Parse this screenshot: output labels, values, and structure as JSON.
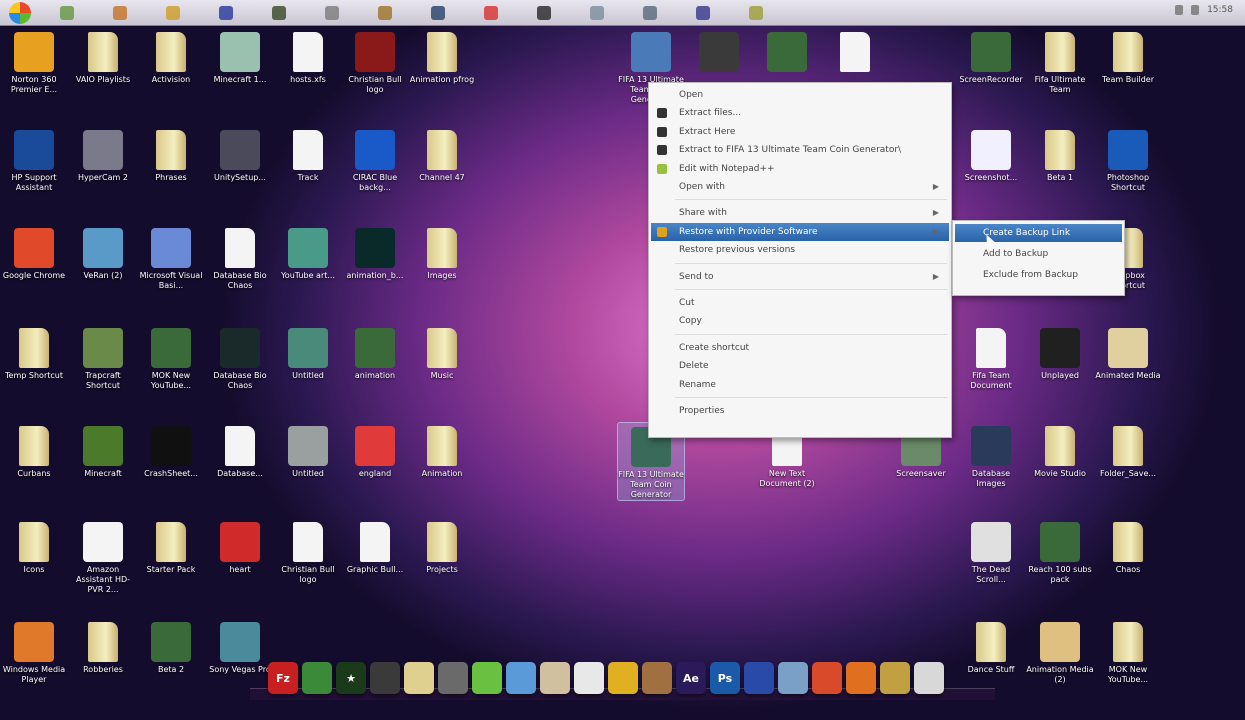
{
  "taskbar": {
    "clock": "15:58",
    "icons": [
      "#6a9a4a",
      "#c87830",
      "#d0a030",
      "#3040a0",
      "#405030",
      "#808080",
      "#a07830",
      "#304a70",
      "#d83a3a",
      "#303030",
      "#8090a0",
      "#607080",
      "#404090",
      "#a0a040"
    ]
  },
  "desktop_icons": [
    {
      "label": "Norton 360 Premier E...",
      "type": "app",
      "color": "#e8a020",
      "col": 0,
      "row": 0
    },
    {
      "label": "VAIO Playlists",
      "type": "folder",
      "col": 1,
      "row": 0
    },
    {
      "label": "Activision",
      "type": "folder",
      "col": 2,
      "row": 0
    },
    {
      "label": "Minecraft 1...",
      "type": "app",
      "color": "#9ac0b0",
      "col": 3,
      "row": 0
    },
    {
      "label": "hosts.xfs",
      "type": "doc",
      "col": 4,
      "row": 0
    },
    {
      "label": "Christian Bull logo",
      "type": "app",
      "color": "#8a1a1a",
      "col": 5,
      "row": 0
    },
    {
      "label": "Animation pfrog",
      "type": "folder",
      "col": 6,
      "row": 0
    },
    {
      "label": "HP Support Assistant",
      "type": "app",
      "color": "#1a4a9a",
      "col": 0,
      "row": 1
    },
    {
      "label": "HyperCam 2",
      "type": "app",
      "color": "#7a7a8a",
      "col": 1,
      "row": 1
    },
    {
      "label": "Phrases",
      "type": "folder",
      "col": 2,
      "row": 1
    },
    {
      "label": "UnitySetup...",
      "type": "app",
      "color": "#4a4a5a",
      "col": 3,
      "row": 1
    },
    {
      "label": "Track",
      "type": "doc",
      "col": 4,
      "row": 1
    },
    {
      "label": "CIRAC Blue backg...",
      "type": "app",
      "color": "#1a5ac8",
      "col": 5,
      "row": 1
    },
    {
      "label": "Channel 47",
      "type": "folder",
      "col": 6,
      "row": 1
    },
    {
      "label": "Google Chrome",
      "type": "app",
      "color": "#e04a2a",
      "col": 0,
      "row": 2
    },
    {
      "label": "VeRan (2)",
      "type": "app",
      "color": "#5a9ac8",
      "col": 1,
      "row": 2
    },
    {
      "label": "Microsoft Visual Basi...",
      "type": "app",
      "color": "#6a8ad8",
      "col": 2,
      "row": 2
    },
    {
      "label": "Database Bio Chaos",
      "type": "doc",
      "col": 3,
      "row": 2
    },
    {
      "label": "YouTube art...",
      "type": "app",
      "color": "#4a9a8a",
      "col": 4,
      "row": 2
    },
    {
      "label": "animation_b...",
      "type": "app",
      "color": "#0a2a2a",
      "col": 5,
      "row": 2
    },
    {
      "label": "Images",
      "type": "folder",
      "col": 6,
      "row": 2
    },
    {
      "label": "Temp Shortcut",
      "type": "folder",
      "col": 0,
      "row": 3
    },
    {
      "label": "Trapcraft Shortcut",
      "type": "app",
      "color": "#6a8a4a",
      "col": 1,
      "row": 3
    },
    {
      "label": "MOK New YouTube...",
      "type": "app",
      "color": "#3a6a3a",
      "col": 2,
      "row": 3
    },
    {
      "label": "Database Bio Chaos",
      "type": "app",
      "color": "#1a2a2a",
      "col": 3,
      "row": 3
    },
    {
      "label": "Untitled",
      "type": "app",
      "color": "#4a8a7a",
      "col": 4,
      "row": 3
    },
    {
      "label": "animation",
      "type": "app",
      "color": "#3a6a3a",
      "col": 5,
      "row": 3
    },
    {
      "label": "Music",
      "type": "folder",
      "col": 6,
      "row": 3
    },
    {
      "label": "Curbans",
      "type": "folder",
      "col": 0,
      "row": 4
    },
    {
      "label": "Minecraft",
      "type": "app",
      "color": "#4a7a2a",
      "col": 1,
      "row": 4
    },
    {
      "label": "CrashSheet...",
      "type": "app",
      "color": "#101010",
      "col": 2,
      "row": 4
    },
    {
      "label": "Database...",
      "type": "doc",
      "col": 3,
      "row": 4
    },
    {
      "label": "Untitled",
      "type": "app",
      "color": "#9aa0a0",
      "col": 4,
      "row": 4
    },
    {
      "label": "england",
      "type": "app",
      "color": "#e03a3a",
      "col": 5,
      "row": 4
    },
    {
      "label": "Animation",
      "type": "folder",
      "col": 6,
      "row": 4
    },
    {
      "label": "Icons",
      "type": "folder",
      "col": 0,
      "row": 5
    },
    {
      "label": "Amazon Assistant HD-PVR 2...",
      "type": "app",
      "color": "#f4f4f4",
      "col": 1,
      "row": 5
    },
    {
      "label": "Starter Pack",
      "type": "folder",
      "col": 2,
      "row": 5
    },
    {
      "label": "heart",
      "type": "app",
      "color": "#d02a2a",
      "col": 3,
      "row": 5
    },
    {
      "label": "Christian Bull logo",
      "type": "doc",
      "col": 4,
      "row": 5
    },
    {
      "label": "Graphic Bull...",
      "type": "doc",
      "col": 5,
      "row": 5
    },
    {
      "label": "Projects",
      "type": "folder",
      "col": 6,
      "row": 5
    },
    {
      "label": "Windows Media Player",
      "type": "app",
      "color": "#e07a2a",
      "col": 0,
      "row": 6
    },
    {
      "label": "Robberies",
      "type": "folder",
      "col": 1,
      "row": 6
    },
    {
      "label": "Beta 2",
      "type": "app",
      "color": "#3a6a3a",
      "col": 2,
      "row": 6
    },
    {
      "label": "Sony Vegas Pro",
      "type": "app",
      "color": "#4a8a9a",
      "col": 3,
      "row": 6
    },
    {
      "label": "FIFA 13 Ultimate Team Coin Generator",
      "type": "app",
      "color": "#4a7ab8",
      "col": 8,
      "row": 0
    },
    {
      "label": "",
      "type": "app",
      "color": "#3a3a3a",
      "col": 9,
      "row": 0
    },
    {
      "label": "",
      "type": "app",
      "color": "#3a6a3a",
      "col": 10,
      "row": 0
    },
    {
      "label": "",
      "type": "doc",
      "col": 11,
      "row": 0
    },
    {
      "label": "FIFA 13 Ultimate Team Coin Generator",
      "type": "app",
      "color": "#3a6a5a",
      "col": 8,
      "row": 4,
      "selected": true
    },
    {
      "label": "New Text Document (2)",
      "type": "doc",
      "col": 10,
      "row": 4
    },
    {
      "label": "Screensaver",
      "type": "app",
      "color": "#6a8a6a",
      "col": 12,
      "row": 4
    },
    {
      "label": "ScreenRecorder",
      "type": "app",
      "color": "#3a6a3a",
      "col": 14,
      "row": 0
    },
    {
      "label": "Fifa Ultimate Team",
      "type": "folder",
      "col": 15,
      "row": 0
    },
    {
      "label": "Team Builder",
      "type": "folder",
      "col": 16,
      "row": 0
    },
    {
      "label": "Screenshot...",
      "type": "app",
      "color": "#f0f0ff",
      "col": 14,
      "row": 1
    },
    {
      "label": "Beta 1",
      "type": "folder",
      "col": 15,
      "row": 1
    },
    {
      "label": "Photoshop Shortcut",
      "type": "app",
      "color": "#1a5ab8",
      "col": 16,
      "row": 1
    },
    {
      "label": "Dropbox Shortcut",
      "type": "folder",
      "col": 16,
      "row": 2
    },
    {
      "label": "Fifa Team Document",
      "type": "doc",
      "col": 14,
      "row": 3
    },
    {
      "label": "Unplayed",
      "type": "app",
      "color": "#202020",
      "col": 15,
      "row": 3
    },
    {
      "label": "Animated Media",
      "type": "app",
      "color": "#e0d0a0",
      "col": 16,
      "row": 3
    },
    {
      "label": "Database Images",
      "type": "app",
      "color": "#2a3a5a",
      "col": 14,
      "row": 4
    },
    {
      "label": "Movie Studio",
      "type": "folder",
      "col": 15,
      "row": 4
    },
    {
      "label": "Folder_Save...",
      "type": "folder",
      "col": 16,
      "row": 4
    },
    {
      "label": "The Dead Scroll...",
      "type": "app",
      "color": "#e0e0e0",
      "col": 14,
      "row": 5
    },
    {
      "label": "Reach 100 subs pack",
      "type": "app",
      "color": "#3a6a3a",
      "col": 15,
      "row": 5
    },
    {
      "label": "Chaos",
      "type": "folder",
      "col": 16,
      "row": 5
    },
    {
      "label": "Dance Stuff",
      "type": "folder",
      "col": 14,
      "row": 6
    },
    {
      "label": "Animation Media (2)",
      "type": "app",
      "color": "#e0c080",
      "col": 15,
      "row": 6
    },
    {
      "label": "MOK New YouTube...",
      "type": "folder",
      "col": 16,
      "row": 6
    }
  ],
  "context_menu": {
    "items": [
      {
        "label": "Open"
      },
      {
        "label": "Extract files...",
        "icon": "#333"
      },
      {
        "label": "Extract Here",
        "icon": "#333"
      },
      {
        "label": "Extract to FIFA 13 Ultimate Team Coin Generator\\",
        "icon": "#333"
      },
      {
        "label": "Edit with Notepad++",
        "icon": "#9ac040"
      },
      {
        "label": "Open with",
        "submenu": true
      },
      {
        "sep": true
      },
      {
        "label": "Share with",
        "submenu": true
      },
      {
        "label": "Restore with Provider Software",
        "icon": "#e0a020",
        "highlighted": true,
        "submenu": true
      },
      {
        "label": "Restore previous versions"
      },
      {
        "sep": true
      },
      {
        "label": "Send to",
        "submenu": true
      },
      {
        "sep": true
      },
      {
        "label": "Cut"
      },
      {
        "label": "Copy"
      },
      {
        "sep": true
      },
      {
        "label": "Create shortcut"
      },
      {
        "label": "Delete"
      },
      {
        "label": "Rename"
      },
      {
        "sep": true
      },
      {
        "label": "Properties"
      }
    ]
  },
  "submenu": {
    "items": [
      {
        "label": "Create Backup Link",
        "highlighted": true
      },
      {
        "label": "Add to Backup"
      },
      {
        "label": "Exclude from Backup"
      }
    ]
  },
  "dock": [
    {
      "name": "filezilla",
      "label": "Fz",
      "color": "#c82020"
    },
    {
      "name": "app-green",
      "label": "",
      "color": "#3a8a3a"
    },
    {
      "name": "app-star",
      "label": "★",
      "color": "#1a3a1a"
    },
    {
      "name": "steam",
      "label": "",
      "color": "#3a3a3a"
    },
    {
      "name": "folder",
      "label": "",
      "color": "#e0d090"
    },
    {
      "name": "app-gray",
      "label": "",
      "color": "#6a6a6a"
    },
    {
      "name": "android",
      "label": "",
      "color": "#6ac040"
    },
    {
      "name": "app-blue",
      "label": "",
      "color": "#5a9ad8"
    },
    {
      "name": "app-photo",
      "label": "",
      "color": "#d0c0a0"
    },
    {
      "name": "safari",
      "label": "",
      "color": "#e8e8e8"
    },
    {
      "name": "app-yellow",
      "label": "",
      "color": "#e0b020"
    },
    {
      "name": "app-brown",
      "label": "",
      "color": "#a07040"
    },
    {
      "name": "after-effects",
      "label": "Ae",
      "color": "#2a1a5a"
    },
    {
      "name": "photoshop",
      "label": "Ps",
      "color": "#1a5aa8"
    },
    {
      "name": "app-globe",
      "label": "",
      "color": "#2a4aa8"
    },
    {
      "name": "app-network",
      "label": "",
      "color": "#7aa0c8"
    },
    {
      "name": "chrome",
      "label": "",
      "color": "#d84a2a"
    },
    {
      "name": "firefox",
      "label": "",
      "color": "#e07020"
    },
    {
      "name": "app-tools",
      "label": "",
      "color": "#c0a040"
    },
    {
      "name": "trash",
      "label": "",
      "color": "#d8d8d8"
    }
  ]
}
